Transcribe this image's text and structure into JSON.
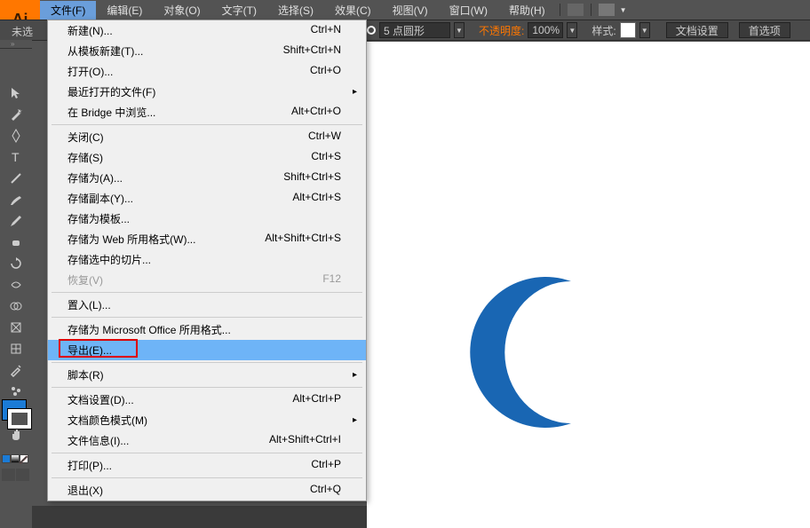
{
  "logo": "Ai",
  "menubar": {
    "file": "文件(F)",
    "edit": "编辑(E)",
    "object": "对象(O)",
    "text": "文字(T)",
    "select": "选择(S)",
    "effect": "效果(C)",
    "view": "视图(V)",
    "window": "窗口(W)",
    "help": "帮助(H)"
  },
  "toolbar": {
    "noselect": "未选",
    "stroke_value": "5 点圆形",
    "opacity_label": "不透明度:",
    "opacity_value": "100%",
    "style_label": "样式:",
    "doc_setup": "文档设置",
    "preferences": "首选项"
  },
  "dropdown": {
    "items": [
      {
        "label": "新建(N)...",
        "shortcut": "Ctrl+N"
      },
      {
        "label": "从模板新建(T)...",
        "shortcut": "Shift+Ctrl+N"
      },
      {
        "label": "打开(O)...",
        "shortcut": "Ctrl+O"
      },
      {
        "label": "最近打开的文件(F)",
        "submenu": true
      },
      {
        "label": "在 Bridge 中浏览...",
        "shortcut": "Alt+Ctrl+O"
      },
      {
        "sep": true
      },
      {
        "label": "关闭(C)",
        "shortcut": "Ctrl+W"
      },
      {
        "label": "存储(S)",
        "shortcut": "Ctrl+S"
      },
      {
        "label": "存储为(A)...",
        "shortcut": "Shift+Ctrl+S"
      },
      {
        "label": "存储副本(Y)...",
        "shortcut": "Alt+Ctrl+S"
      },
      {
        "label": "存储为模板..."
      },
      {
        "label": "存储为 Web 所用格式(W)...",
        "shortcut": "Alt+Shift+Ctrl+S"
      },
      {
        "label": "存储选中的切片..."
      },
      {
        "label": "恢复(V)",
        "shortcut": "F12",
        "disabled": true
      },
      {
        "sep": true
      },
      {
        "label": "置入(L)..."
      },
      {
        "sep": true
      },
      {
        "label": "存储为 Microsoft Office 所用格式..."
      },
      {
        "label": "导出(E)...",
        "hover": true
      },
      {
        "sep": true
      },
      {
        "label": "脚本(R)",
        "submenu": true
      },
      {
        "sep": true
      },
      {
        "label": "文档设置(D)...",
        "shortcut": "Alt+Ctrl+P"
      },
      {
        "label": "文档颜色模式(M)",
        "submenu": true
      },
      {
        "label": "文件信息(I)...",
        "shortcut": "Alt+Shift+Ctrl+I"
      },
      {
        "sep": true
      },
      {
        "label": "打印(P)...",
        "shortcut": "Ctrl+P"
      },
      {
        "sep": true
      },
      {
        "label": "退出(X)",
        "shortcut": "Ctrl+Q"
      }
    ]
  },
  "tools": [
    "selection",
    "direct",
    "magic-wand",
    "pen",
    "type",
    "line",
    "rectangle",
    "paintbrush",
    "pencil",
    "blob",
    "eraser",
    "rotate",
    "scale",
    "width",
    "free",
    "shape-builder",
    "mesh",
    "gradient",
    "eyedropper",
    "blend",
    "symbol",
    "column",
    "artboard",
    "slice",
    "hand"
  ],
  "colors": {
    "fill": "#1b7bd6"
  },
  "chart_data": null
}
